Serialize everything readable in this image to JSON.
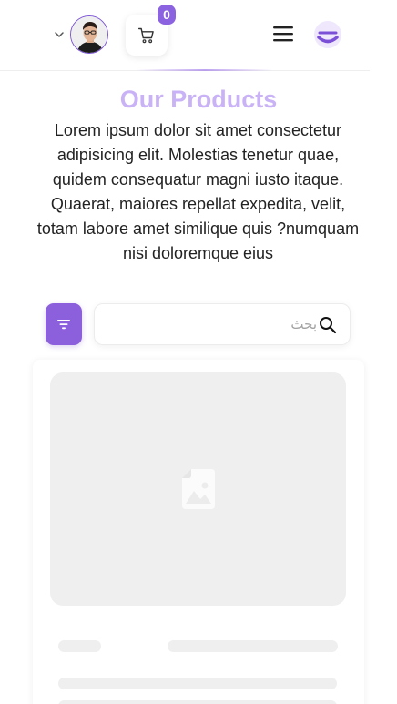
{
  "header": {
    "user_menu_chevron_icon": "chevron-down-icon",
    "avatar_alt": "User avatar",
    "cart_icon": "cart-icon",
    "cart_count": "0",
    "menu_icon": "hamburger-menu-icon",
    "logo_icon": "brand-logo-icon"
  },
  "main": {
    "title": "Our Products",
    "description": "Lorem ipsum dolor sit amet consectetur adipisicing elit. Molestias tenetur quae, quidem consequatur magni iusto itaque. Quaerat, maiores repellat expedita, velit, totam labore amet similique quis ?numquam nisi doloremque eius"
  },
  "search": {
    "placeholder": "بحث",
    "value": "",
    "filter_icon": "filter-icon",
    "search_icon": "search-icon"
  },
  "product_card": {
    "state": "loading",
    "image_placeholder_icon": "image-placeholder-icon"
  },
  "colors": {
    "accent": "#8c5fdc",
    "title": "#c9b3f6",
    "skeleton": "#efefef",
    "text": "#222222"
  }
}
